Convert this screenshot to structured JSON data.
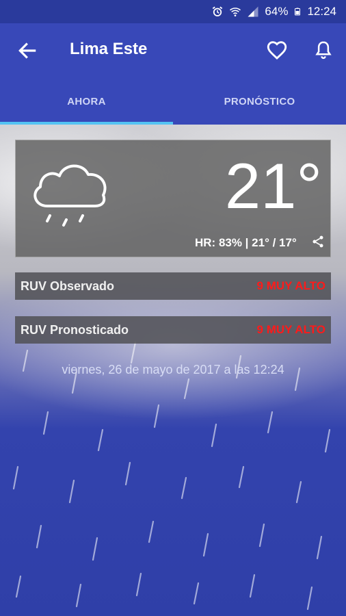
{
  "status_bar": {
    "battery": "64%",
    "time": "12:24"
  },
  "header": {
    "title": "Lima Este",
    "icons": [
      "arrow-back-icon",
      "heart-outline-icon",
      "bell-icon"
    ]
  },
  "tabs": [
    {
      "label": "AHORA",
      "active": true
    },
    {
      "label": "PRONÓSTICO",
      "active": false
    }
  ],
  "weather": {
    "condition_icon": "cloud-rain-icon",
    "temperature": "21°",
    "details": "HR: 83% | 21° / 17°"
  },
  "uv": [
    {
      "label": "RUV Observado",
      "value": "9 MUY ALTO"
    },
    {
      "label": "RUV Pronosticado",
      "value": "9 MUY ALTO"
    }
  ],
  "updated": "viernes, 26 de mayo de 2017 a las 12:24",
  "colors": {
    "primary": "#3848b8",
    "status_bar": "#2a3a9c",
    "tab_indicator": "#53c3f3",
    "uv_value": "#ff1a1a"
  }
}
